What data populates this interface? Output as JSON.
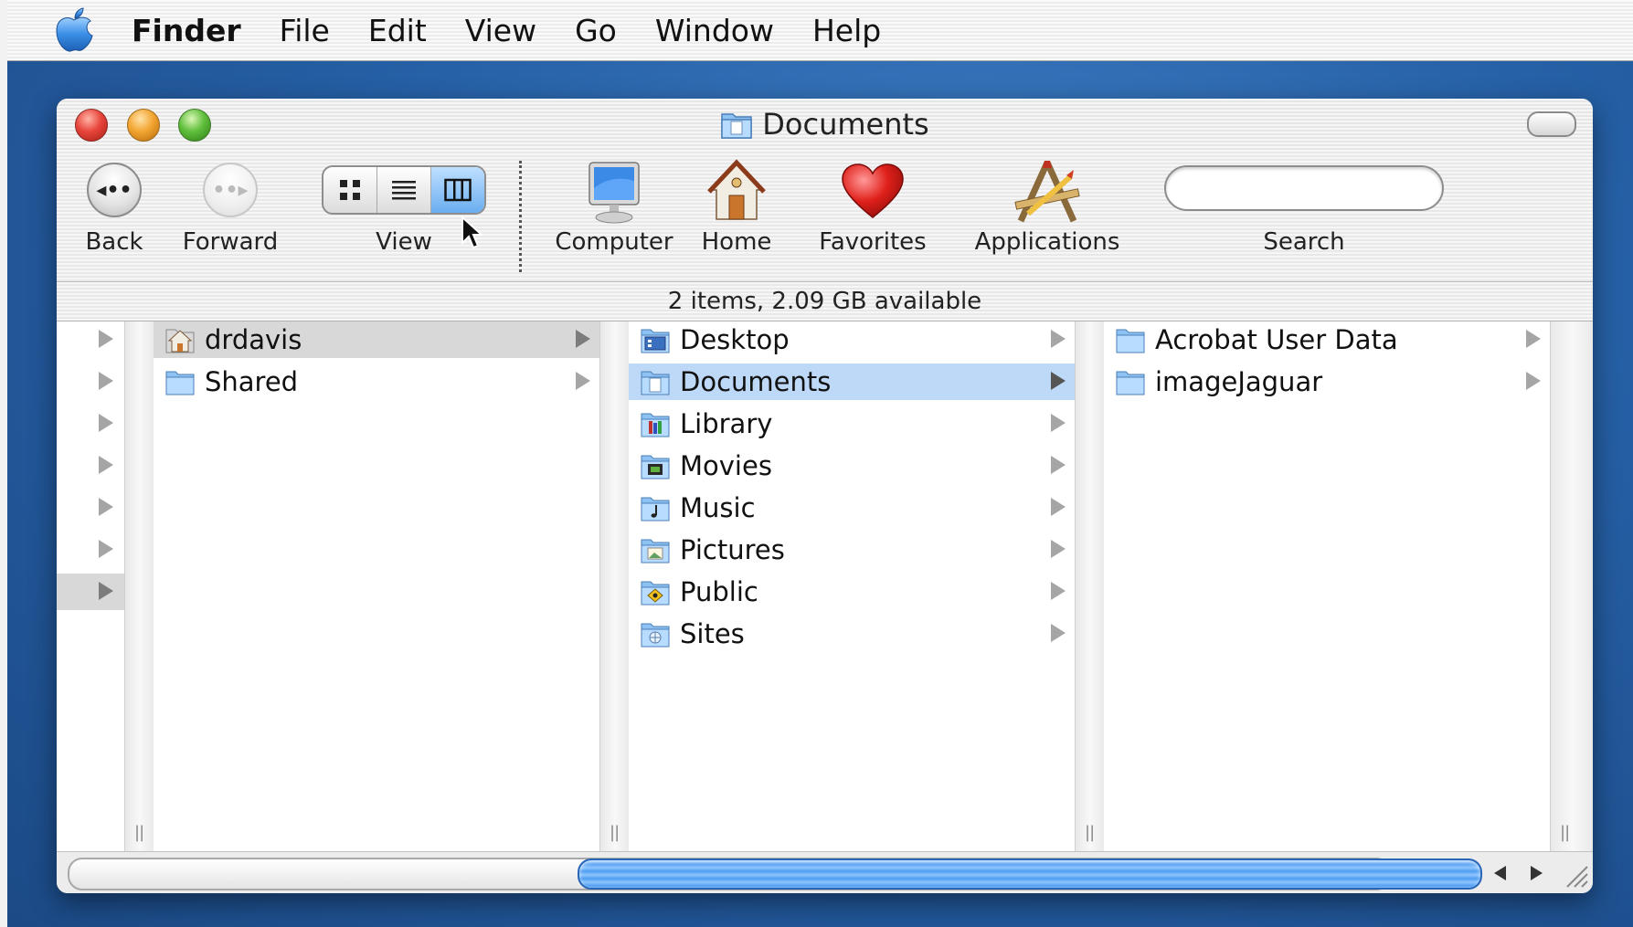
{
  "menubar": {
    "app_name": "Finder",
    "items": [
      "File",
      "Edit",
      "View",
      "Go",
      "Window",
      "Help"
    ]
  },
  "window": {
    "title": "Documents"
  },
  "toolbar": {
    "back_label": "Back",
    "forward_label": "Forward",
    "view_label": "View",
    "computer_label": "Computer",
    "home_label": "Home",
    "favorites_label": "Favorites",
    "applications_label": "Applications",
    "search_label": "Search",
    "search_value": "",
    "active_view": "columns"
  },
  "status": {
    "text": "2 items, 2.09 GB available"
  },
  "columns": {
    "col1": [
      {
        "label": "drdavis",
        "icon": "home-folder-icon",
        "selected": "gray"
      },
      {
        "label": "Shared",
        "icon": "folder-icon",
        "selected": ""
      }
    ],
    "col2": [
      {
        "label": "Desktop",
        "icon": "desktop-folder-icon",
        "selected": ""
      },
      {
        "label": "Documents",
        "icon": "documents-folder-icon",
        "selected": "blue"
      },
      {
        "label": "Library",
        "icon": "library-folder-icon",
        "selected": ""
      },
      {
        "label": "Movies",
        "icon": "movies-folder-icon",
        "selected": ""
      },
      {
        "label": "Music",
        "icon": "music-folder-icon",
        "selected": ""
      },
      {
        "label": "Pictures",
        "icon": "pictures-folder-icon",
        "selected": ""
      },
      {
        "label": "Public",
        "icon": "public-folder-icon",
        "selected": ""
      },
      {
        "label": "Sites",
        "icon": "sites-folder-icon",
        "selected": ""
      }
    ],
    "col3": [
      {
        "label": "Acrobat User Data",
        "icon": "folder-icon",
        "selected": ""
      },
      {
        "label": "imageJaguar",
        "icon": "folder-icon",
        "selected": ""
      }
    ]
  },
  "colors": {
    "selection_blue": "#bed8f7",
    "selection_gray": "#d8d8d8",
    "scroll_thumb": "#4f9cf0"
  }
}
